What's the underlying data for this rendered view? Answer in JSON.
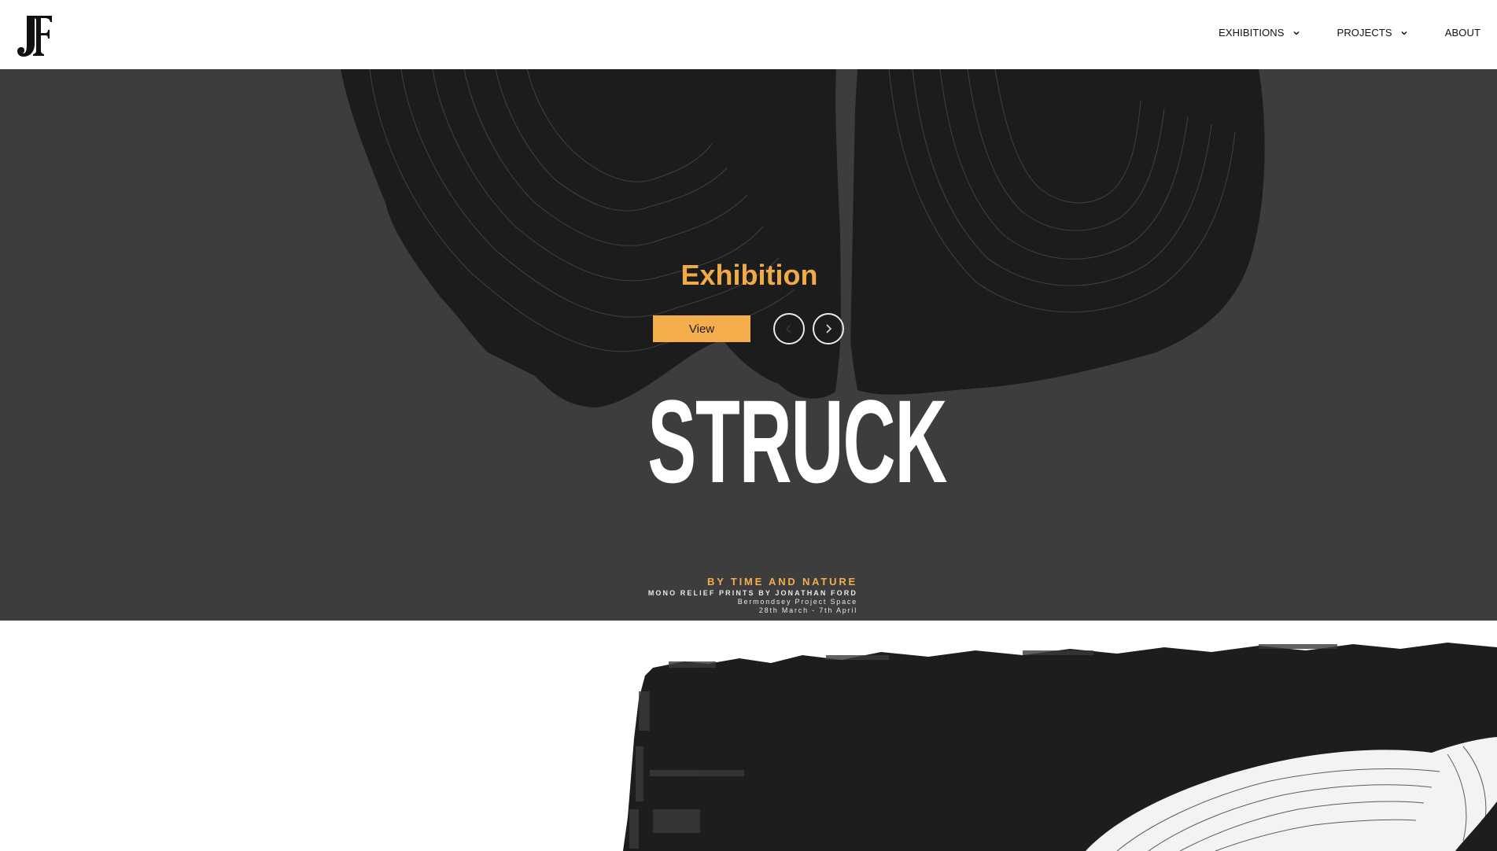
{
  "header": {
    "logo_alt": "JF",
    "nav": [
      {
        "label": "EXHIBITIONS",
        "has_dropdown": true
      },
      {
        "label": "PROJECTS",
        "has_dropdown": true
      },
      {
        "label": "ABOUT",
        "has_dropdown": false
      }
    ]
  },
  "hero": {
    "category": "Exhibition",
    "view_label": "View",
    "poster": {
      "title": "STRUCK",
      "subtitle": "BY TIME AND NATURE",
      "line1": "MONO RELIEF PRINTS BY JONATHAN FORD",
      "line2": "Bermondsey Project Space",
      "line3": "28th March - 7th April"
    },
    "background_image": "tree-stump-print",
    "colors": {
      "accent": "#f4ae4b",
      "title": "#f0ab47",
      "background": "#3d3d3e"
    }
  },
  "lower": {
    "image": "black-ink-print-with-wood-grain"
  }
}
